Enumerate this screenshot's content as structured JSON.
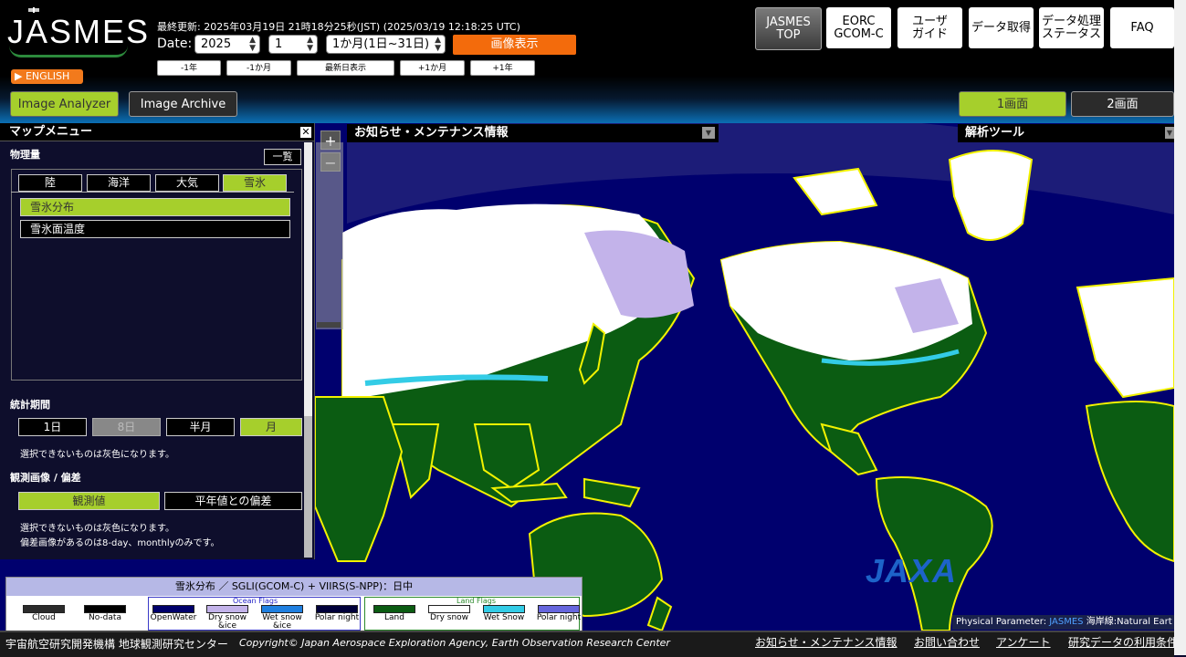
{
  "header": {
    "logo": "JASMES",
    "english_label": "ENGLISH",
    "last_update": "最終更新: 2025年03月19日 21時18分25秒(JST) (2025/03/19 12:18:25 UTC)",
    "date_label": "Date:",
    "year_value": "2025",
    "month_value": "1",
    "range_value": "1か月(1日~31日)",
    "show_button": "画像表示",
    "nav": [
      "-1年",
      "-1か月",
      "最新日表示",
      "+1か月",
      "+1年"
    ],
    "top_buttons": [
      "JASMES\nTOP",
      "EORC\nGCOM-C",
      "ユーザ\nガイド",
      "データ取得",
      "データ処理\nステータス",
      "FAQ"
    ],
    "image_analyzer": "Image Analyzer",
    "image_archive": "Image Archive",
    "view_one": "1画面",
    "view_two": "2画面"
  },
  "panel": {
    "title": "マップメニュー",
    "physical_label": "物理量",
    "list_button": "一覧",
    "categories": [
      "陸",
      "海洋",
      "大気",
      "雪氷"
    ],
    "items": [
      "雪氷分布",
      "雪氷面温度"
    ],
    "period_label": "統計期間",
    "periods": [
      "1日",
      "8日",
      "半月",
      "月"
    ],
    "gray_note": "選択できないものは灰色になります。",
    "obs_label": "観測画像 / 偏差",
    "obs_options": [
      "観測値",
      "平年値との偏差"
    ],
    "gray_note2": "選択できないものは灰色になります。",
    "anomaly_note": "偏差画像があるのは8-day、monthlyのみです。"
  },
  "notice": {
    "title": "お知らせ・メンテナンス情報"
  },
  "tools": {
    "title": "解析ツール"
  },
  "zoom": {
    "plus": "+",
    "minus": "−"
  },
  "map": {
    "jaxa_logo": "JAXA",
    "attribution_param": "Physical Parameter:",
    "attribution_coast": "海岸線:Natural Eart"
  },
  "legend": {
    "title": "雪氷分布 ／ SGLI(GCOM-C) + VIIRS(S-NPP)：日中",
    "ocean_flags": "Ocean Flags",
    "land_flags": "Land Flags",
    "entries": [
      {
        "label": "Cloud",
        "color": "#2b2b2b"
      },
      {
        "label": "No-data",
        "color": "#000000"
      },
      {
        "label": "OpenWater",
        "color": "#00006b"
      },
      {
        "label": "Dry snow &ice",
        "color": "#c3b3ea"
      },
      {
        "label": "Wet snow &ice",
        "color": "#1f7fe0"
      },
      {
        "label": "Polar night",
        "color": "#00003a"
      },
      {
        "label": "Land",
        "color": "#0b5c12"
      },
      {
        "label": "Dry snow",
        "color": "#ffffff"
      },
      {
        "label": "Wet Snow",
        "color": "#33cce6"
      },
      {
        "label": "Polar night",
        "color": "#6666dd"
      }
    ]
  },
  "footer": {
    "org": "宇宙航空研究開発機構 地球観測研究センター",
    "copyright": "Copyright© Japan Aerospace Exploration Agency, Earth Observation Research Center",
    "links": [
      "お知らせ・メンテナンス情報",
      "お問い合わせ",
      "アンケート",
      "研究データの利用条件"
    ]
  }
}
